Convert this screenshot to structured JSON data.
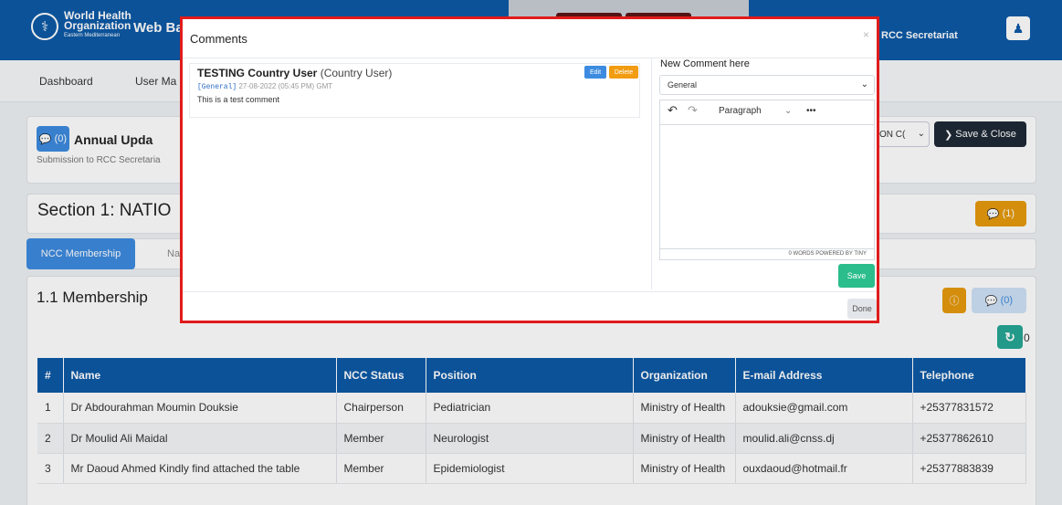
{
  "header": {
    "org_name_line1": "World Health",
    "org_name_line2": "Organization",
    "org_sub": "Eastern Mediterranean",
    "app_title": "Web Ba",
    "role": "RCC Secretariat"
  },
  "nav": {
    "items": [
      "Dashboard",
      "User Ma"
    ]
  },
  "annual": {
    "comment_count": "(0)",
    "title": "Annual Upda",
    "subtitle": "Submission to RCC Secretaria",
    "select_value": "ON C(",
    "save_close_label": "Save & Close"
  },
  "section": {
    "title": "Section 1: NATIO",
    "comment_count": "(1)"
  },
  "tabs": {
    "active": "NCC Membership",
    "inactive": "Na"
  },
  "membership": {
    "title": "1.1 Membership",
    "comment_count": "(0)",
    "refresh_count": "0"
  },
  "table": {
    "headers": [
      "#",
      "Name",
      "NCC Status",
      "Position",
      "Organization",
      "E-mail Address",
      "Telephone"
    ],
    "rows": [
      [
        "1",
        "Dr Abdourahman Moumin Douksie",
        "Chairperson",
        "Pediatrician",
        "Ministry of Health",
        "adouksie@gmail.com",
        "+25377831572"
      ],
      [
        "2",
        "Dr Moulid Ali Maidal",
        "Member",
        "Neurologist",
        "Ministry of Health",
        "moulid.ali@cnss.dj",
        "+25377862610"
      ],
      [
        "3",
        "Mr Daoud Ahmed Kindly find attached the table",
        "Member",
        "Epidemiologist",
        "Ministry of Health",
        "ouxdaoud@hotmail.fr",
        "+25377883839"
      ]
    ]
  },
  "modal": {
    "title": "Comments",
    "close": "×",
    "comment": {
      "user": "TESTING Country User",
      "role": "(Country User)",
      "tag": "[General]",
      "timestamp": "27-08-2022 (05:45 PM) GMT",
      "text": "This is a test comment",
      "edit_label": "Edit",
      "delete_label": "Delete"
    },
    "new_comment_label": "New Comment here",
    "category_value": "General",
    "editor": {
      "block_format": "Paragraph",
      "more": "•••",
      "status": "0 WORDS  POWERED BY TINY"
    },
    "save_label": "Save",
    "done_label": "Done"
  },
  "colors": {
    "primary": "#0d5aa7",
    "accent_blue": "#3d8be0",
    "orange": "#e79b0e",
    "teal": "#25a795",
    "green": "#2bbd8c",
    "highlight_border": "#e01b1b"
  }
}
